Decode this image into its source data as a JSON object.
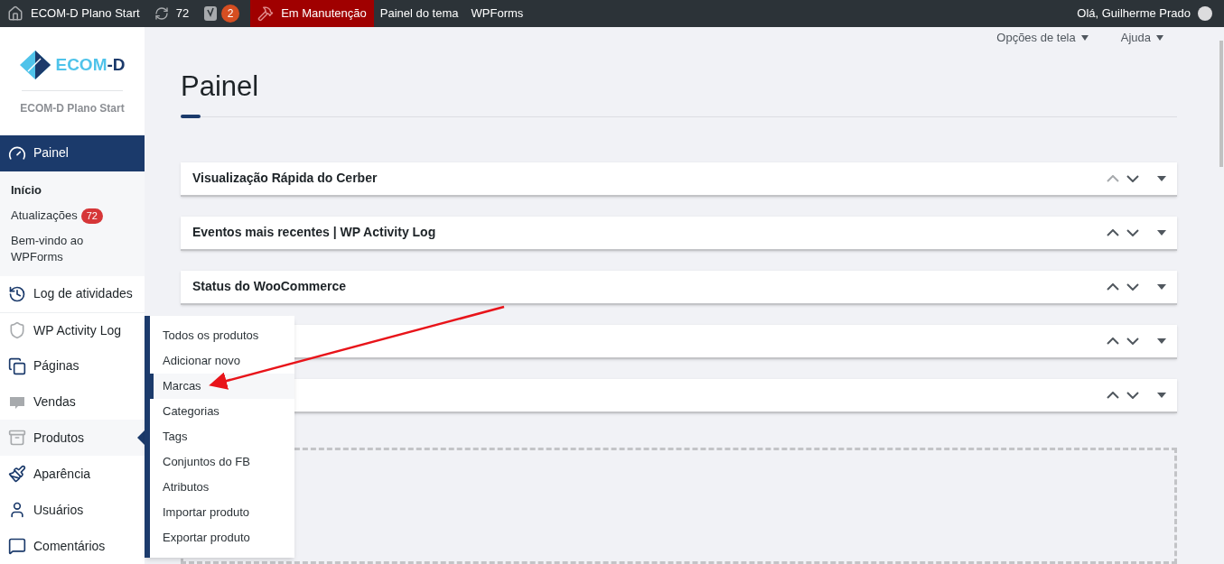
{
  "admin_bar": {
    "site": "ECOM-D Plano Start",
    "updates": "72",
    "seo_badge": "2",
    "maintenance": "Em Manutenção",
    "links": [
      "Painel do tema",
      "WPForms"
    ],
    "greeting": "Olá, Guilherme Prado"
  },
  "logo": {
    "parts": [
      {
        "text": "ECOM",
        "color": "#4fc3ea"
      },
      {
        "text": "-D",
        "color": "#1b3a6b"
      }
    ],
    "subtitle": "ECOM-D Plano Start"
  },
  "sidebar": {
    "items": [
      {
        "label": "Painel",
        "kind": "gauge",
        "selected": true,
        "open": false,
        "children": [
          {
            "label": "Início",
            "selected": true
          },
          {
            "label": "Atualizações",
            "badge": "72",
            "selected": false
          },
          {
            "label": "Bem-vindo ao WPForms",
            "selected": false
          }
        ]
      },
      {
        "label": "Log de atividades",
        "kind": "history",
        "selected": false,
        "open": false,
        "separator": false
      },
      {
        "label": "WP Activity Log",
        "kind": "shield",
        "selected": false,
        "open": false,
        "separator": true
      },
      {
        "label": "Páginas",
        "kind": "pages",
        "selected": false,
        "open": false,
        "separator": false
      },
      {
        "label": "Vendas",
        "kind": "woo",
        "selected": false,
        "open": false,
        "separator": false
      },
      {
        "label": "Produtos",
        "kind": "box",
        "selected": false,
        "open": true,
        "separator": false
      },
      {
        "label": "Aparência",
        "kind": "brush",
        "selected": false,
        "open": false,
        "separator": false
      },
      {
        "label": "Usuários",
        "kind": "user",
        "selected": false,
        "open": false,
        "separator": false
      },
      {
        "label": "Comentários",
        "kind": "comment",
        "selected": false,
        "open": false,
        "separator": false
      }
    ]
  },
  "flyout": {
    "items": [
      {
        "label": "Todos os produtos",
        "selected": false
      },
      {
        "label": "Adicionar novo",
        "selected": false
      },
      {
        "label": "Marcas",
        "selected": true
      },
      {
        "label": "Categorias",
        "selected": false
      },
      {
        "label": "Tags",
        "selected": false
      },
      {
        "label": "Conjuntos do FB",
        "selected": false
      },
      {
        "label": "Atributos",
        "selected": false
      },
      {
        "label": "Importar produto",
        "selected": false
      },
      {
        "label": "Exportar produto",
        "selected": false
      }
    ]
  },
  "header": {
    "screen_options": "Opções de tela",
    "help": "Ajuda",
    "title": "Painel"
  },
  "widgets": [
    {
      "title": "Visualização Rápida do Cerber",
      "up_disabled": true
    },
    {
      "title": "Eventos mais recentes | WP Activity Log",
      "up_disabled": false
    },
    {
      "title": "Status do WooCommerce",
      "up_disabled": false
    },
    {
      "up_disabled": false
    },
    {
      "up_disabled": false
    }
  ]
}
